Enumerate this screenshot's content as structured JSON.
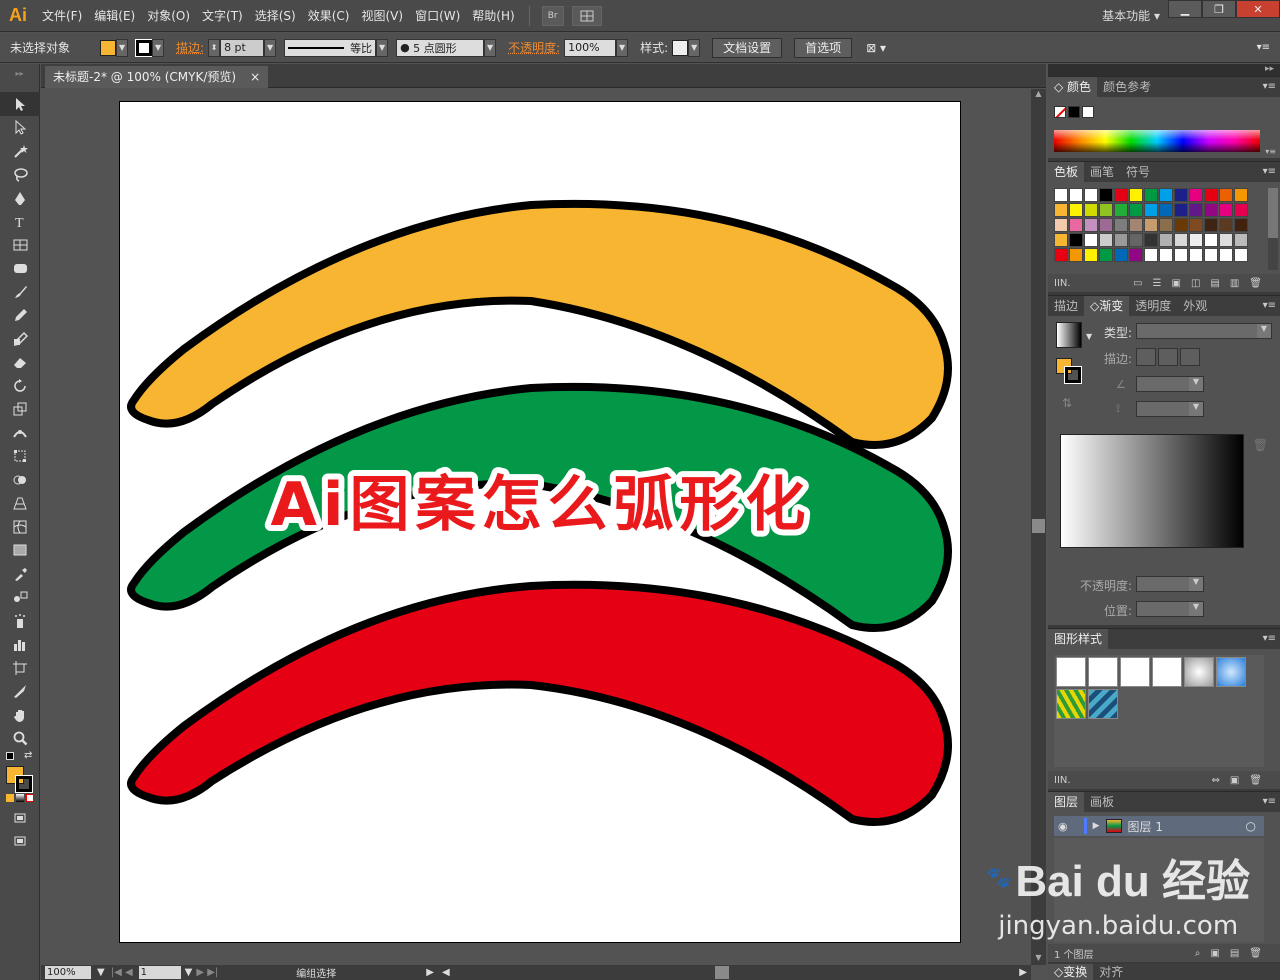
{
  "app": {
    "logo": "Ai"
  },
  "menu": [
    "文件(F)",
    "编辑(E)",
    "对象(O)",
    "文字(T)",
    "选择(S)",
    "效果(C)",
    "视图(V)",
    "窗口(W)",
    "帮助(H)"
  ],
  "bridge_label": "Br",
  "workspace": "基本功能",
  "control": {
    "selection_label": "未选择对象",
    "fill_color": "#f7b531",
    "stroke_label": "描边:",
    "stroke_value": "8 pt",
    "profile_label": "等比",
    "brush_label": "5 点圆形",
    "opacity_label": "不透明度:",
    "opacity_value": "100%",
    "style_label": "样式:",
    "doc_setup": "文档设置",
    "preferences": "首选项"
  },
  "document": {
    "tab_title": "未标题-2* @ 100% (CMYK/预览)",
    "close": "×"
  },
  "artwork": {
    "title": "Ai图案怎么弧形化",
    "arc_colors": [
      "#f7b531",
      "#039847",
      "#e50014"
    ],
    "title_color": "#e9191c"
  },
  "status": {
    "zoom": "100%",
    "page": "1",
    "mode": "编组选择"
  },
  "panels": {
    "color_tabs": [
      "颜色",
      "颜色参考"
    ],
    "swatch_tabs": [
      "色板",
      "画笔",
      "符号"
    ],
    "gradient_tabs": [
      "描边",
      "渐变",
      "透明度",
      "外观"
    ],
    "gradient_type_label": "类型:",
    "gradient_stroke_label": "描边:",
    "gradient_opacity_label": "不透明度:",
    "gradient_location_label": "位置:",
    "graphic_styles_tab": "图形样式",
    "layer_tabs": [
      "图层",
      "画板"
    ],
    "layer_name": "图层 1",
    "layer_count": "1 个图层",
    "bottom_tabs": [
      "变换",
      "对齐"
    ]
  },
  "swatches": [
    "#ffffff",
    "#ffffff",
    "#ffffff",
    "#000000",
    "#e50014",
    "#fff100",
    "#009944",
    "#00a0e9",
    "#1d2088",
    "#e4007f",
    "#e60012",
    "#eb6100",
    "#f39800",
    "#f7b531",
    "#fff100",
    "#cfdb00",
    "#8fc31f",
    "#22ac38",
    "#009944",
    "#00a0e9",
    "#0068b7",
    "#1d2088",
    "#601986",
    "#920783",
    "#e4007f",
    "#e5004f",
    "#f2c9ac",
    "#ea68a2",
    "#c490bf",
    "#9d6a96",
    "#7d7d7d",
    "#a38671",
    "#c69c6d",
    "#8b6e4b",
    "#6a3906",
    "#7f4a21",
    "#3e2413",
    "#5c3a21",
    "#40220f",
    "#f7b531",
    "#000000",
    "#ffffff",
    "#cccccc",
    "#999999",
    "#666666",
    "#333333",
    "#b0b0b0",
    "#d8d8d8",
    "#eeeeee",
    "#ffffff",
    "#dddddd",
    "#bbbbbb",
    "#e60012",
    "#f39800",
    "#fff100",
    "#009944",
    "#0068b7",
    "#920783",
    "#ffffff",
    "#ffffff",
    "#ffffff",
    "#ffffff",
    "#ffffff",
    "#ffffff",
    "#ffffff"
  ],
  "watermark": {
    "brand": "Bai du 经验",
    "url": "jingyan.baidu.com"
  }
}
